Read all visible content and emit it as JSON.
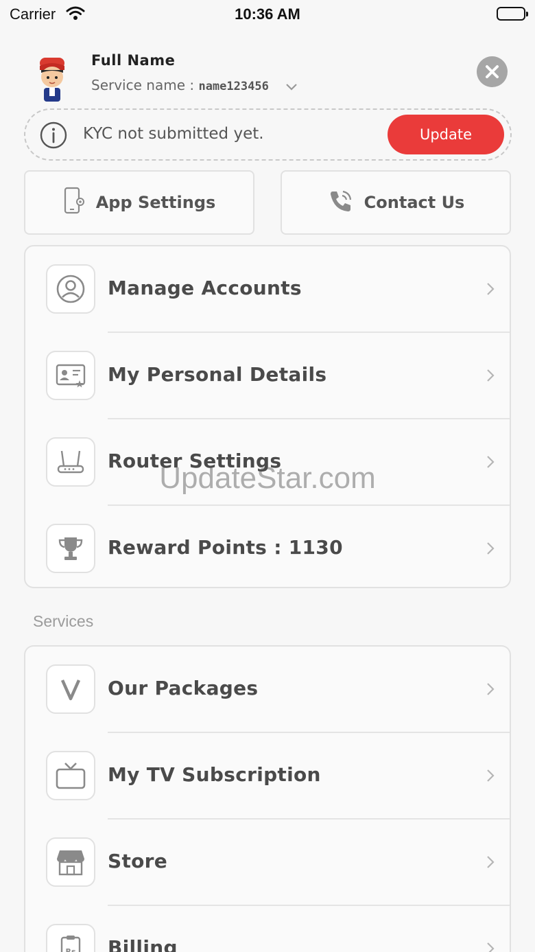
{
  "status_bar": {
    "carrier": "Carrier",
    "time": "10:36 AM"
  },
  "profile": {
    "full_name": "Full Name",
    "service_label": "Service name : ",
    "service_value": "name123456"
  },
  "kyc": {
    "message": "KYC not submitted yet.",
    "button_label": "Update"
  },
  "quick_actions": {
    "app_settings": "App Settings",
    "contact_us": "Contact Us"
  },
  "account_menu": [
    {
      "label": "Manage Accounts",
      "icon": "user-circle-icon"
    },
    {
      "label": "My Personal Details",
      "icon": "id-card-icon"
    },
    {
      "label": "Router Settings",
      "icon": "router-icon"
    },
    {
      "label": "Reward Points : 1130",
      "icon": "trophy-icon"
    }
  ],
  "services_section": {
    "label": "Services"
  },
  "services_menu": [
    {
      "label": "Our Packages",
      "icon": "packages-icon"
    },
    {
      "label": "My TV Subscription",
      "icon": "tv-icon"
    },
    {
      "label": "Store",
      "icon": "store-icon"
    },
    {
      "label": "Billing",
      "icon": "billing-icon"
    }
  ],
  "watermark": "UpdateStar.com",
  "colors": {
    "accent": "#ea3b3a",
    "background": "#f7f7f7",
    "icon_gray": "#8a8a8a"
  }
}
